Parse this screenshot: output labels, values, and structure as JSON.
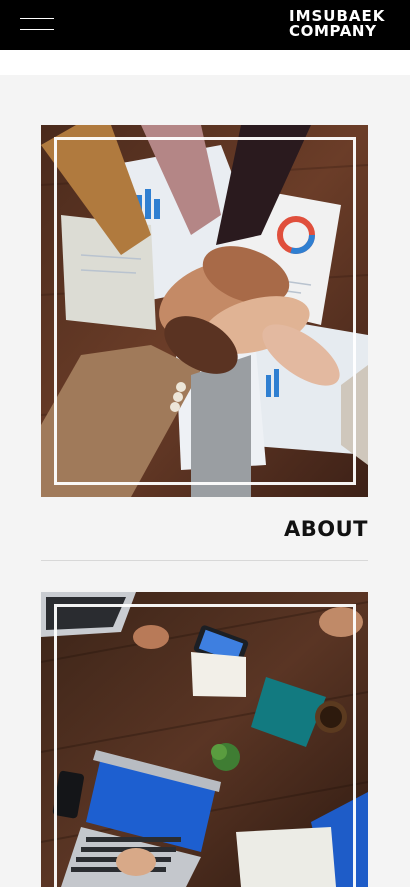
{
  "header": {
    "menu_icon": "hamburger-menu-icon",
    "logo_line1": "IMSUBAEK",
    "logo_line2": "COMPANY"
  },
  "sections": [
    {
      "title": "ABOUT",
      "image": "hands-stacked-teamwork-photo"
    },
    {
      "image": "office-desk-laptops-photo"
    }
  ],
  "colors": {
    "header_bg": "#000000",
    "page_bg": "#f4f4f4",
    "frame": "#ffffff"
  }
}
